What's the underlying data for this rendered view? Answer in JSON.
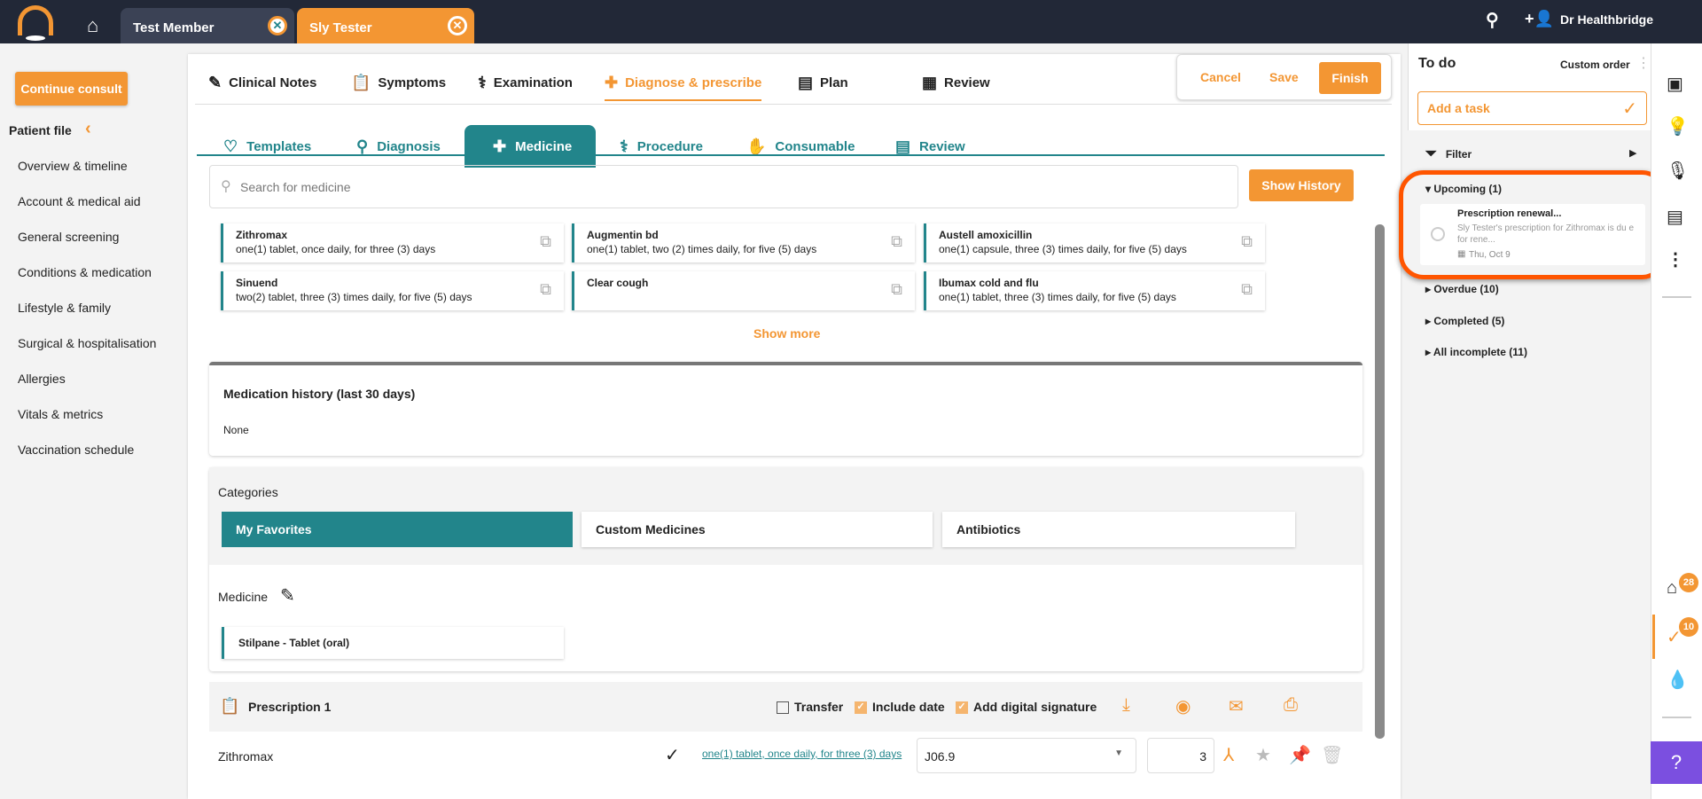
{
  "topbar": {
    "tabs": [
      {
        "label": "Test Member"
      },
      {
        "label": "Sly Tester"
      }
    ],
    "user": "Dr Healthbridge"
  },
  "sidebar": {
    "continue_label": "Continue consult",
    "patient_file": "Patient file",
    "items": [
      "Overview & timeline",
      "Account & medical aid",
      "General screening",
      "Conditions & medication",
      "Lifestyle & family",
      "Surgical & hospitalisation",
      "Allergies",
      "Vitals & metrics",
      "Vaccination schedule"
    ]
  },
  "nav": {
    "tabs": [
      "Clinical Notes",
      "Symptoms",
      "Examination",
      "Diagnose & prescribe",
      "Plan",
      "Review"
    ],
    "cancel": "Cancel",
    "save": "Save",
    "finish": "Finish"
  },
  "subtabs": [
    "Templates",
    "Diagnosis",
    "Medicine",
    "Procedure",
    "Consumable",
    "Review"
  ],
  "search": {
    "placeholder": "Search for medicine",
    "show_history": "Show History"
  },
  "medicines": [
    {
      "name": "Zithromax",
      "dose": "one(1) tablet, once daily, for three (3) days"
    },
    {
      "name": "Augmentin bd",
      "dose": "one(1) tablet, two (2) times daily, for five (5) days"
    },
    {
      "name": "Austell amoxicillin",
      "dose": "one(1) capsule, three (3) times daily, for five (5) days"
    },
    {
      "name": "Sinuend",
      "dose": "two(2) tablet, three (3) times daily, for five (5) days"
    },
    {
      "name": "Clear cough",
      "dose": ""
    },
    {
      "name": "Ibumax cold and flu",
      "dose": "one(1) tablet, three (3) times daily, for five (5) days"
    }
  ],
  "show_more": "Show more",
  "history": {
    "title": "Medication history (last 30 days)",
    "value": "None"
  },
  "categories": {
    "title": "Categories",
    "items": [
      "My Favorites",
      "Custom Medicines",
      "Antibiotics"
    ],
    "medicine_label": "Medicine",
    "selected": "Stilpane - Tablet (oral)"
  },
  "prescription": {
    "title": "Prescription 1",
    "transfer": "Transfer",
    "include_date": "Include date",
    "signature": "Add digital signature",
    "item": {
      "name": "Zithromax",
      "dose": "one(1) tablet, once daily, for three (3) days",
      "icd": "J06.9",
      "qty": "3"
    }
  },
  "todo": {
    "title": "To do",
    "order": "Custom order",
    "add": "Add a task",
    "filter": "Filter",
    "upcoming": "Upcoming (1)",
    "task": {
      "title": "Prescription renewal...",
      "desc": "Sly Tester's prescription for Zithromax is du e for rene...",
      "date": "Thu, Oct 9"
    },
    "groups": [
      "Overdue (10)",
      "Completed (5)",
      "All incomplete (11)"
    ]
  },
  "rail": {
    "badge1": "28",
    "badge2": "10"
  },
  "colors": {
    "accent": "#f39633",
    "teal": "#22858b",
    "highlight": "#ff5500"
  }
}
